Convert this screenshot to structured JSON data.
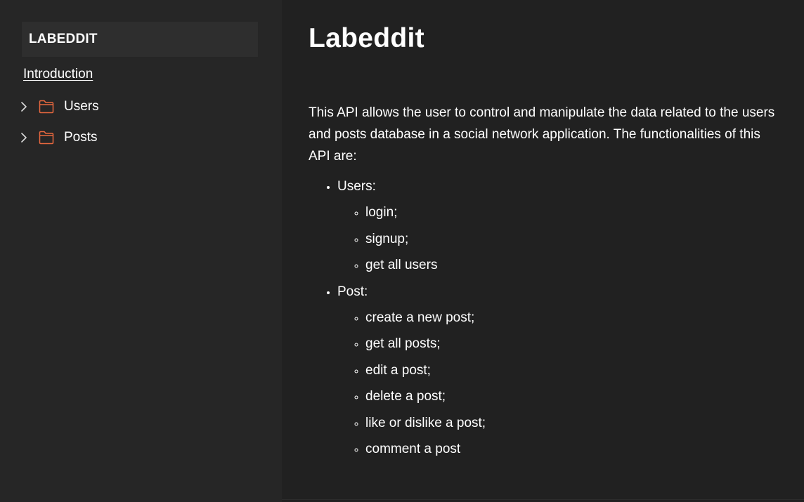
{
  "sidebar": {
    "title": "LABEDDIT",
    "intro_link": "Introduction",
    "items": [
      {
        "label": "Users",
        "icon": "folder-icon",
        "expand_icon": "chevron-right-icon"
      },
      {
        "label": "Posts",
        "icon": "folder-icon",
        "expand_icon": "chevron-right-icon"
      }
    ]
  },
  "main": {
    "title": "Labeddit",
    "description": "This API allows the user to control and manipulate the data related to the users and posts database in a social network application. The functionalities of this API are:",
    "features": [
      {
        "label": "Users:",
        "items": [
          "login;",
          "signup;",
          "get all users"
        ]
      },
      {
        "label": "Post:",
        "items": [
          "create a new post;",
          "get all posts;",
          "edit a post;",
          "delete a post;",
          "like or dislike a post;",
          "comment a post"
        ]
      }
    ]
  },
  "colors": {
    "sidebar_bg": "#262626",
    "main_bg": "#212121",
    "header_bg": "#2e2e2e",
    "folder_accent": "#e8683f",
    "text": "#ffffff"
  }
}
